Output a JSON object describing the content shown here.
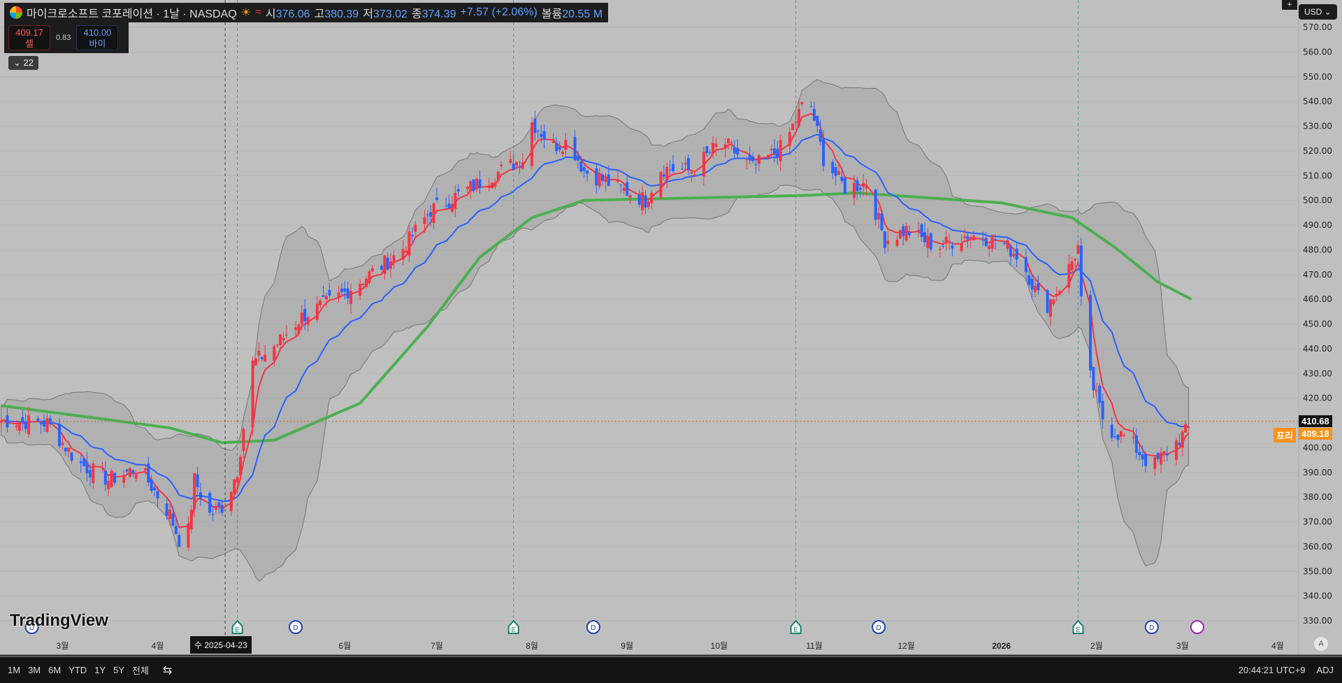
{
  "header": {
    "title": "마이크로소프트 코포레이션 · 1날 · NASDAQ",
    "open_label": "시",
    "open": "376.06",
    "high_label": "고",
    "high": "380.39",
    "low_label": "저",
    "low": "373.02",
    "close_label": "종",
    "close": "374.39",
    "change": "+7.57 (+2.06%)",
    "volume_label": "볼륨",
    "volume": "20.55 M"
  },
  "trade": {
    "sell_price": "409.17",
    "sell_label": "셀",
    "spread": "0.83",
    "buy_price": "410.00",
    "buy_label": "바이"
  },
  "indicators_toggle": "22",
  "currency": "USD",
  "price_axis": {
    "ticks": [
      "570.00",
      "560.00",
      "550.00",
      "540.00",
      "530.00",
      "520.00",
      "510.00",
      "500.00",
      "490.00",
      "480.00",
      "470.00",
      "460.00",
      "450.00",
      "440.00",
      "430.00",
      "420.00",
      "400.00",
      "390.00",
      "380.00",
      "370.00",
      "360.00",
      "350.00",
      "340.00",
      "330.00"
    ],
    "last_price": "410.68",
    "pre_label": "프리",
    "pre_price": "409.18"
  },
  "time_axis": {
    "labels": [
      "3월",
      "4월",
      "6월",
      "7월",
      "8월",
      "9월",
      "10월",
      "11월",
      "12월",
      "2026",
      "2월",
      "3월",
      "4월"
    ],
    "crosshair": "수 2025-04-23",
    "auto": "A"
  },
  "watermark": "TradingView",
  "bottom": {
    "ranges": [
      "1M",
      "3M",
      "6M",
      "YTD",
      "1Y",
      "5Y",
      "전체"
    ],
    "clock": "20:44:21 UTC+9",
    "adj": "ADJ"
  },
  "colors": {
    "up": "#f23645",
    "down": "#2962ff",
    "ma": "#4caf50",
    "band": "#a0a0a0",
    "bg": "#bfbfbf"
  },
  "chart_data": {
    "type": "candlestick",
    "symbol": "MSFT",
    "interval": "1D",
    "ylim": [
      325,
      575
    ],
    "x_start": "2025-03-01",
    "close_anchors_days_from_mar1": [
      [
        -20,
        411
      ],
      [
        -5,
        410
      ],
      [
        5,
        394
      ],
      [
        15,
        387
      ],
      [
        25,
        392
      ],
      [
        35,
        373
      ],
      [
        40,
        356
      ],
      [
        43,
        387
      ],
      [
        48,
        373
      ],
      [
        53,
        377
      ],
      [
        57,
        391
      ],
      [
        62,
        434
      ],
      [
        70,
        442
      ],
      [
        78,
        453
      ],
      [
        90,
        461
      ],
      [
        100,
        470
      ],
      [
        110,
        479
      ],
      [
        120,
        496
      ],
      [
        130,
        503
      ],
      [
        140,
        510
      ],
      [
        150,
        517
      ],
      [
        152,
        533
      ],
      [
        155,
        529
      ],
      [
        160,
        522
      ],
      [
        165,
        524
      ],
      [
        170,
        512
      ],
      [
        178,
        507
      ],
      [
        185,
        503
      ],
      [
        190,
        500
      ],
      [
        195,
        513
      ],
      [
        205,
        512
      ],
      [
        215,
        524
      ],
      [
        225,
        513
      ],
      [
        235,
        522
      ],
      [
        243,
        543
      ],
      [
        248,
        517
      ],
      [
        255,
        505
      ],
      [
        262,
        507
      ],
      [
        268,
        484
      ],
      [
        275,
        488
      ],
      [
        285,
        481
      ],
      [
        295,
        486
      ],
      [
        305,
        484
      ],
      [
        312,
        477
      ],
      [
        320,
        456
      ],
      [
        326,
        467
      ],
      [
        331,
        481
      ],
      [
        333,
        436
      ],
      [
        340,
        408
      ],
      [
        347,
        404
      ],
      [
        355,
        392
      ],
      [
        362,
        401
      ],
      [
        368,
        409
      ]
    ],
    "ma200_anchors": [
      [
        -20,
        417
      ],
      [
        35,
        408
      ],
      [
        52,
        402
      ],
      [
        69,
        403
      ],
      [
        97,
        418
      ],
      [
        119,
        449
      ],
      [
        136,
        477
      ],
      [
        153,
        493
      ],
      [
        170,
        500
      ],
      [
        242,
        502
      ],
      [
        259,
        503
      ],
      [
        306,
        499
      ],
      [
        329,
        493
      ],
      [
        343,
        481
      ],
      [
        357,
        467
      ],
      [
        368,
        460
      ]
    ],
    "earnings_days": [
      57,
      147,
      239,
      331
    ],
    "dividend_days": [
      -10,
      76,
      173,
      266,
      355
    ],
    "crosshair_day": 53
  }
}
